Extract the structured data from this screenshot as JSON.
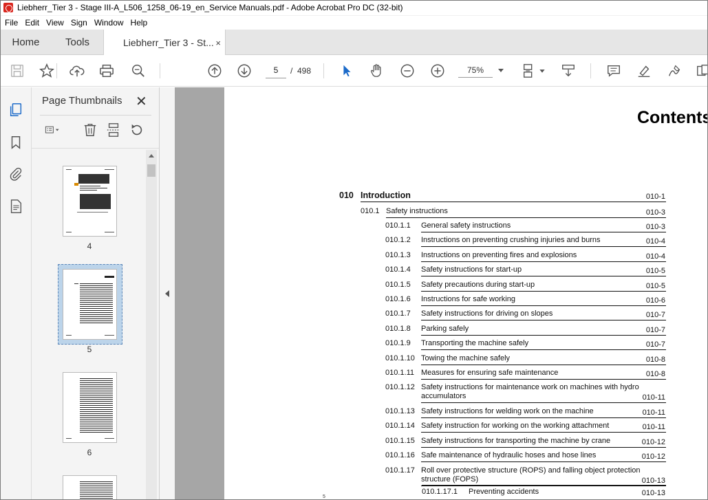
{
  "window": {
    "title": "Liebherr_Tier 3 - Stage III-A_L506_1258_06-19_en_Service Manuals.pdf - Adobe Acrobat Pro DC (32-bit)"
  },
  "menu": [
    "File",
    "Edit",
    "View",
    "Sign",
    "Window",
    "Help"
  ],
  "tabs": {
    "home": "Home",
    "tools": "Tools",
    "document": "Liebherr_Tier 3 - St...",
    "close": "×"
  },
  "toolbar": {
    "current_page": "5",
    "separator": "/",
    "total_pages": "498",
    "zoom": "75%",
    "icons": [
      "save-icon",
      "star-icon",
      "upload-icon",
      "print-icon",
      "zoom-search-icon",
      "prev-page-icon",
      "next-page-icon",
      "select-cursor-icon",
      "hand-icon",
      "zoom-out-icon",
      "zoom-in-icon",
      "fit-page-icon",
      "scroll-mode-icon",
      "comment-icon",
      "highlight-icon",
      "sign-icon",
      "more-tools-icon"
    ]
  },
  "sidebar": {
    "panel_title": "Page Thumbnails",
    "close": "✕",
    "thumbnails": [
      {
        "label": "4"
      },
      {
        "label": "5",
        "selected": true
      },
      {
        "label": "6"
      }
    ]
  },
  "document": {
    "heading": "Contents",
    "footer_mark": "5",
    "section": {
      "num": "010",
      "title": "Introduction",
      "page": "010-1"
    },
    "subsection": {
      "num": "010.1",
      "title": "Safety instructions",
      "page": "010-3"
    },
    "entries": [
      {
        "num": "010.1.1",
        "title": "General safety instructions",
        "page": "010-3"
      },
      {
        "num": "010.1.2",
        "title": "Instructions on preventing crushing injuries and burns",
        "page": "010-4"
      },
      {
        "num": "010.1.3",
        "title": "Instructions on preventing fires and explosions",
        "page": "010-4"
      },
      {
        "num": "010.1.4",
        "title": "Safety instructions for start-up",
        "page": "010-5"
      },
      {
        "num": "010.1.5",
        "title": "Safety precautions during start-up",
        "page": "010-5"
      },
      {
        "num": "010.1.6",
        "title": "Instructions for safe working",
        "page": "010-6"
      },
      {
        "num": "010.1.7",
        "title": "Safety instructions for driving on slopes",
        "page": "010-7"
      },
      {
        "num": "010.1.8",
        "title": "Parking safely",
        "page": "010-7"
      },
      {
        "num": "010.1.9",
        "title": "Transporting the machine safely",
        "page": "010-7"
      },
      {
        "num": "010.1.10",
        "title": "Towing the machine safely",
        "page": "010-8"
      },
      {
        "num": "010.1.11",
        "title": "Measures for ensuring safe maintenance",
        "page": "010-8"
      },
      {
        "num": "010.1.12",
        "title": "Safety instructions for maintenance work on machines with hydro",
        "title2": "accumulators",
        "page": "010-11"
      },
      {
        "num": "010.1.13",
        "title": "Safety instructions for welding work on the machine",
        "page": "010-11"
      },
      {
        "num": "010.1.14",
        "title": "Safety instruction for working on the working attachment",
        "page": "010-11"
      },
      {
        "num": "010.1.15",
        "title": "Safety instructions for transporting the machine by crane",
        "page": "010-12"
      },
      {
        "num": "010.1.16",
        "title": "Safe maintenance of hydraulic hoses and hose lines",
        "page": "010-12"
      },
      {
        "num": "010.1.17",
        "title": "Roll over protective structure (ROPS) and falling object protection",
        "title2": "structure (FOPS)",
        "page": "010-13"
      }
    ],
    "sub_entry": {
      "num": "010.1.17.1",
      "title": "Preventing accidents",
      "page": "010-13"
    }
  }
}
